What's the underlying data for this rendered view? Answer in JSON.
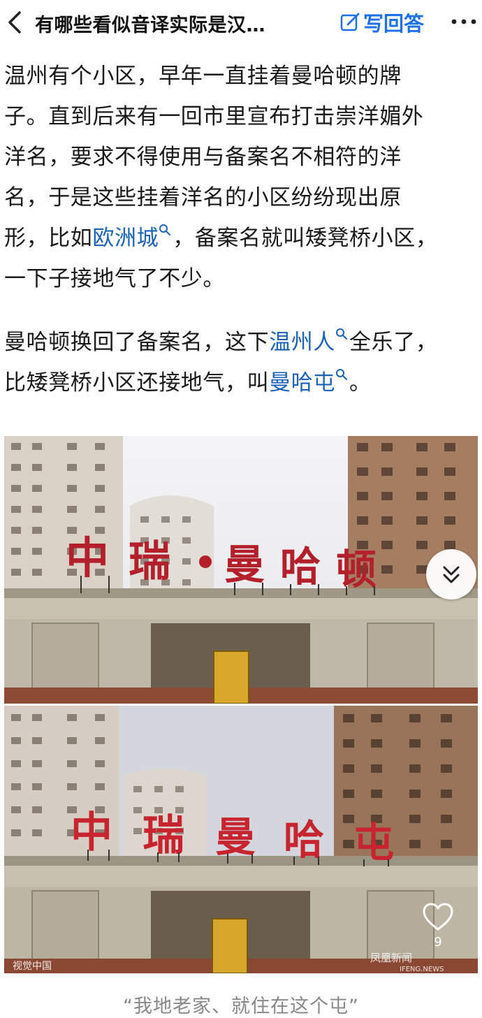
{
  "header": {
    "title": "有哪些看似音译实际是汉…",
    "write_answer_label": "写回答"
  },
  "article": {
    "p1_lines": [
      "温州有个小区，早年一直挂着曼哈顿的牌",
      "子。直到后来有一回市里宣布打击崇洋媚外",
      "洋名，要求不得使用与备案名不相符的洋",
      "名，于是这些挂着洋名的小区纷纷现出原"
    ],
    "p1_line5_pre": "形，比如",
    "p1_link1": "欧洲城",
    "p1_line5_post": "，备案名就叫矮凳桥小区，",
    "p1_line6": "一下子接地气了不少。",
    "p2_line1_pre": "曼哈顿换回了备案名，这下",
    "p2_link1": "温州人",
    "p2_line1_post": "全乐了，",
    "p2_line2_pre": "比矮凳桥小区还接地气，叫",
    "p2_link2": "曼哈屯",
    "p2_line2_post": "。"
  },
  "photo1": {
    "sign_chars": [
      "中",
      "瑞",
      "曼",
      "哈",
      "顿"
    ]
  },
  "photo2": {
    "sign_chars": [
      "中",
      "瑞",
      "曼",
      "哈",
      "屯"
    ]
  },
  "photo_overlay": {
    "like_count": "9",
    "watermark_left": "视觉中国",
    "watermark_right": "凤凰新闻",
    "watermark_right_sub": "IFENG.NEWS"
  },
  "caption": "“我地老家、就住在这个屯”",
  "colors": {
    "link": "#1b62b8",
    "accent": "#1e70e8",
    "sign_red": "#b3202c"
  }
}
